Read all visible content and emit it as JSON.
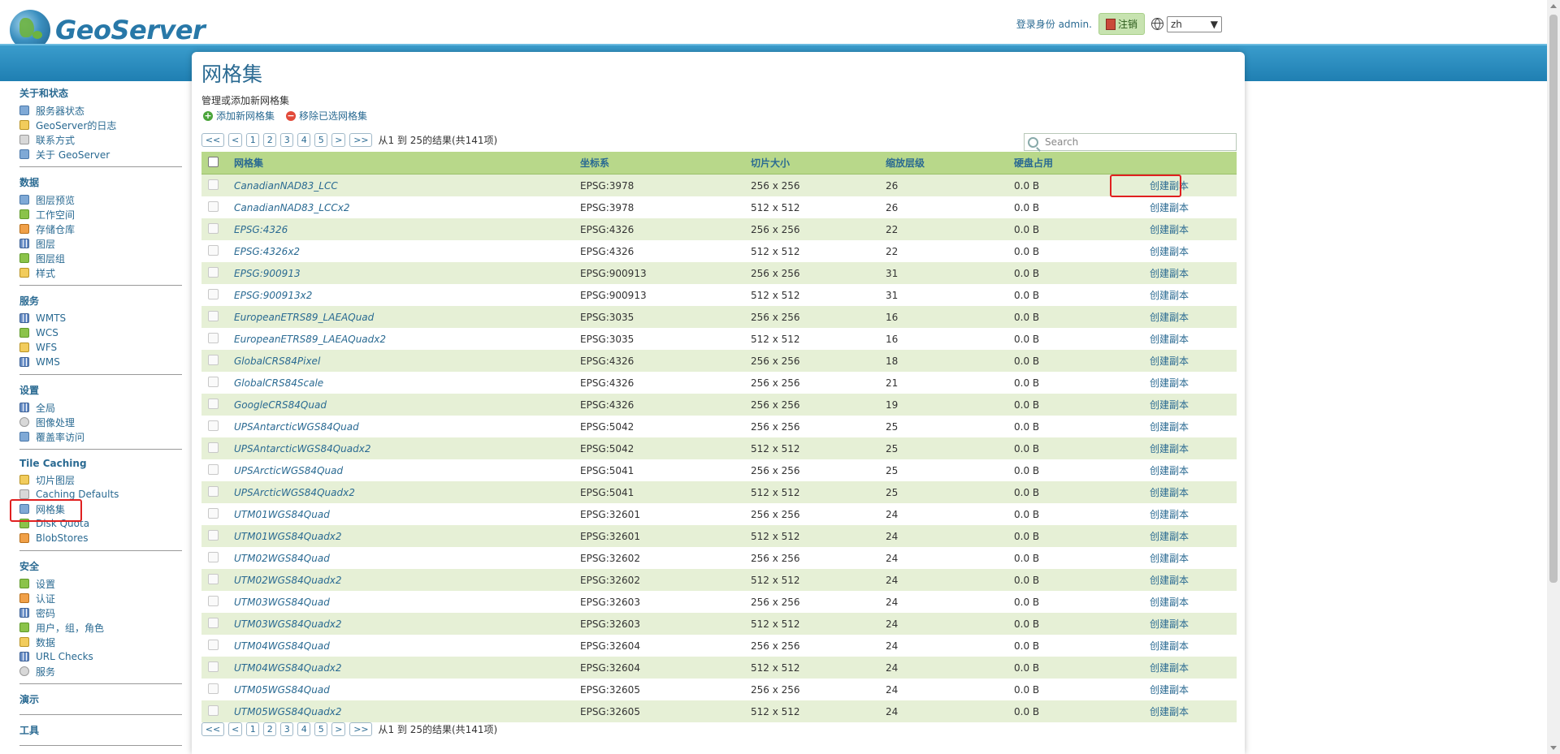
{
  "header": {
    "app_name": "GeoServer",
    "logged_in_text": "登录身份 admin.",
    "logout_label": "注销",
    "language": "zh"
  },
  "sidebar": {
    "groups": [
      {
        "title": "关于和状态",
        "items": [
          {
            "label": "服务器状态",
            "icon": "server-status-icon"
          },
          {
            "label": "GeoServer的日志",
            "icon": "log-icon"
          },
          {
            "label": "联系方式",
            "icon": "contact-icon"
          },
          {
            "label": "关于 GeoServer",
            "icon": "about-icon"
          }
        ]
      },
      {
        "title": "数据",
        "items": [
          {
            "label": "图层预览",
            "icon": "layer-preview-icon"
          },
          {
            "label": "工作空间",
            "icon": "workspace-icon"
          },
          {
            "label": "存储仓库",
            "icon": "store-icon"
          },
          {
            "label": "图层",
            "icon": "layer-icon"
          },
          {
            "label": "图层组",
            "icon": "layer-group-icon"
          },
          {
            "label": "样式",
            "icon": "style-icon"
          }
        ]
      },
      {
        "title": "服务",
        "items": [
          {
            "label": "WMTS",
            "icon": "wmts-icon"
          },
          {
            "label": "WCS",
            "icon": "wcs-icon"
          },
          {
            "label": "WFS",
            "icon": "wfs-icon"
          },
          {
            "label": "WMS",
            "icon": "wms-icon"
          }
        ]
      },
      {
        "title": "设置",
        "items": [
          {
            "label": "全局",
            "icon": "global-icon"
          },
          {
            "label": "图像处理",
            "icon": "image-processing-icon"
          },
          {
            "label": "覆盖率访问",
            "icon": "coverage-access-icon"
          }
        ]
      },
      {
        "title": "Tile Caching",
        "items": [
          {
            "label": "切片图层",
            "icon": "tile-layers-icon"
          },
          {
            "label": "Caching Defaults",
            "icon": "caching-defaults-icon"
          },
          {
            "label": "网格集",
            "icon": "gridsets-icon"
          },
          {
            "label": "Disk Quota",
            "icon": "disk-quota-icon"
          },
          {
            "label": "BlobStores",
            "icon": "blobstores-icon"
          }
        ]
      },
      {
        "title": "安全",
        "items": [
          {
            "label": "设置",
            "icon": "security-settings-icon"
          },
          {
            "label": "认证",
            "icon": "authentication-icon"
          },
          {
            "label": "密码",
            "icon": "password-icon"
          },
          {
            "label": "用户，组，角色",
            "icon": "users-groups-roles-icon"
          },
          {
            "label": "数据",
            "icon": "data-security-icon"
          },
          {
            "label": "URL Checks",
            "icon": "url-checks-icon"
          },
          {
            "label": "服务",
            "icon": "service-security-icon"
          }
        ]
      },
      {
        "title": "演示",
        "items": []
      },
      {
        "title": "工具",
        "items": []
      }
    ]
  },
  "main": {
    "title": "网格集",
    "subtitle": "管理或添加新网格集",
    "add_label": "添加新网格集",
    "remove_label": "移除已选网格集",
    "search_placeholder": "Search",
    "pager": {
      "first": "<<",
      "prev": "<",
      "pages": [
        "1",
        "2",
        "3",
        "4",
        "5"
      ],
      "next": ">",
      "last": ">>",
      "info": "从1 到 25的结果(共141项)"
    },
    "columns": [
      "网格集",
      "坐标系",
      "切片大小",
      "缩放层级",
      "硬盘占用"
    ],
    "copy_label": "创建副本",
    "rows": [
      {
        "name": "CanadianNAD83_LCC",
        "crs": "EPSG:3978",
        "tile": "256 x 256",
        "zoom": "26",
        "disk": "0.0 B"
      },
      {
        "name": "CanadianNAD83_LCCx2",
        "crs": "EPSG:3978",
        "tile": "512 x 512",
        "zoom": "26",
        "disk": "0.0 B"
      },
      {
        "name": "EPSG:4326",
        "crs": "EPSG:4326",
        "tile": "256 x 256",
        "zoom": "22",
        "disk": "0.0 B"
      },
      {
        "name": "EPSG:4326x2",
        "crs": "EPSG:4326",
        "tile": "512 x 512",
        "zoom": "22",
        "disk": "0.0 B"
      },
      {
        "name": "EPSG:900913",
        "crs": "EPSG:900913",
        "tile": "256 x 256",
        "zoom": "31",
        "disk": "0.0 B"
      },
      {
        "name": "EPSG:900913x2",
        "crs": "EPSG:900913",
        "tile": "512 x 512",
        "zoom": "31",
        "disk": "0.0 B"
      },
      {
        "name": "EuropeanETRS89_LAEAQuad",
        "crs": "EPSG:3035",
        "tile": "256 x 256",
        "zoom": "16",
        "disk": "0.0 B"
      },
      {
        "name": "EuropeanETRS89_LAEAQuadx2",
        "crs": "EPSG:3035",
        "tile": "512 x 512",
        "zoom": "16",
        "disk": "0.0 B"
      },
      {
        "name": "GlobalCRS84Pixel",
        "crs": "EPSG:4326",
        "tile": "256 x 256",
        "zoom": "18",
        "disk": "0.0 B"
      },
      {
        "name": "GlobalCRS84Scale",
        "crs": "EPSG:4326",
        "tile": "256 x 256",
        "zoom": "21",
        "disk": "0.0 B"
      },
      {
        "name": "GoogleCRS84Quad",
        "crs": "EPSG:4326",
        "tile": "256 x 256",
        "zoom": "19",
        "disk": "0.0 B"
      },
      {
        "name": "UPSAntarcticWGS84Quad",
        "crs": "EPSG:5042",
        "tile": "256 x 256",
        "zoom": "25",
        "disk": "0.0 B"
      },
      {
        "name": "UPSAntarcticWGS84Quadx2",
        "crs": "EPSG:5042",
        "tile": "512 x 512",
        "zoom": "25",
        "disk": "0.0 B"
      },
      {
        "name": "UPSArcticWGS84Quad",
        "crs": "EPSG:5041",
        "tile": "256 x 256",
        "zoom": "25",
        "disk": "0.0 B"
      },
      {
        "name": "UPSArcticWGS84Quadx2",
        "crs": "EPSG:5041",
        "tile": "512 x 512",
        "zoom": "25",
        "disk": "0.0 B"
      },
      {
        "name": "UTM01WGS84Quad",
        "crs": "EPSG:32601",
        "tile": "256 x 256",
        "zoom": "24",
        "disk": "0.0 B"
      },
      {
        "name": "UTM01WGS84Quadx2",
        "crs": "EPSG:32601",
        "tile": "512 x 512",
        "zoom": "24",
        "disk": "0.0 B"
      },
      {
        "name": "UTM02WGS84Quad",
        "crs": "EPSG:32602",
        "tile": "256 x 256",
        "zoom": "24",
        "disk": "0.0 B"
      },
      {
        "name": "UTM02WGS84Quadx2",
        "crs": "EPSG:32602",
        "tile": "512 x 512",
        "zoom": "24",
        "disk": "0.0 B"
      },
      {
        "name": "UTM03WGS84Quad",
        "crs": "EPSG:32603",
        "tile": "256 x 256",
        "zoom": "24",
        "disk": "0.0 B"
      },
      {
        "name": "UTM03WGS84Quadx2",
        "crs": "EPSG:32603",
        "tile": "512 x 512",
        "zoom": "24",
        "disk": "0.0 B"
      },
      {
        "name": "UTM04WGS84Quad",
        "crs": "EPSG:32604",
        "tile": "256 x 256",
        "zoom": "24",
        "disk": "0.0 B"
      },
      {
        "name": "UTM04WGS84Quadx2",
        "crs": "EPSG:32604",
        "tile": "512 x 512",
        "zoom": "24",
        "disk": "0.0 B"
      },
      {
        "name": "UTM05WGS84Quad",
        "crs": "EPSG:32605",
        "tile": "256 x 256",
        "zoom": "24",
        "disk": "0.0 B"
      },
      {
        "name": "UTM05WGS84Quadx2",
        "crs": "EPSG:32605",
        "tile": "512 x 512",
        "zoom": "24",
        "disk": "0.0 B"
      }
    ]
  },
  "colors": {
    "accent": "#2a6a92",
    "header_band": "#1f7fb2",
    "table_header": "#b8d88a",
    "row_alt": "#e6f0d6",
    "highlight": "#e02020"
  }
}
